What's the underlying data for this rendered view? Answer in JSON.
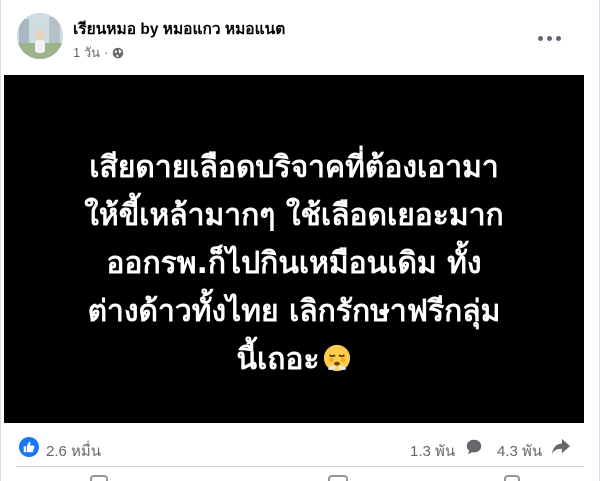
{
  "post": {
    "author": "เรียนหมอ by หมอแกว หมอแนต",
    "time": "1 วัน",
    "separator": "·",
    "privacy_icon": "globe-icon",
    "more_icon": "more-options-icon",
    "text_lines": [
      "เสียดายเลือดบริจาคที่ต้องเอามา",
      "ให้ขี้เหล้ามากๆ ใช้เลือดเยอะมาก",
      "ออกรพ.ก็ไปกินเหมือนเดิม ทั้ง",
      "ต่างด้าวทั้งไทย เลิกรักษาฟรีกลุ่ม",
      "นี้เถอะ"
    ],
    "emoji": "face-exhaling-emoji",
    "background_color": "#000000",
    "text_color": "#ffffff"
  },
  "stats": {
    "reaction_icon": "like-icon",
    "reactions": "2.6 หมื่น",
    "comments": "1.3 พัน",
    "comment_icon": "comment-icon",
    "shares": "4.3 พัน",
    "share_icon": "share-icon"
  },
  "colors": {
    "accent": "#1877f2",
    "secondary_text": "#65676b"
  }
}
